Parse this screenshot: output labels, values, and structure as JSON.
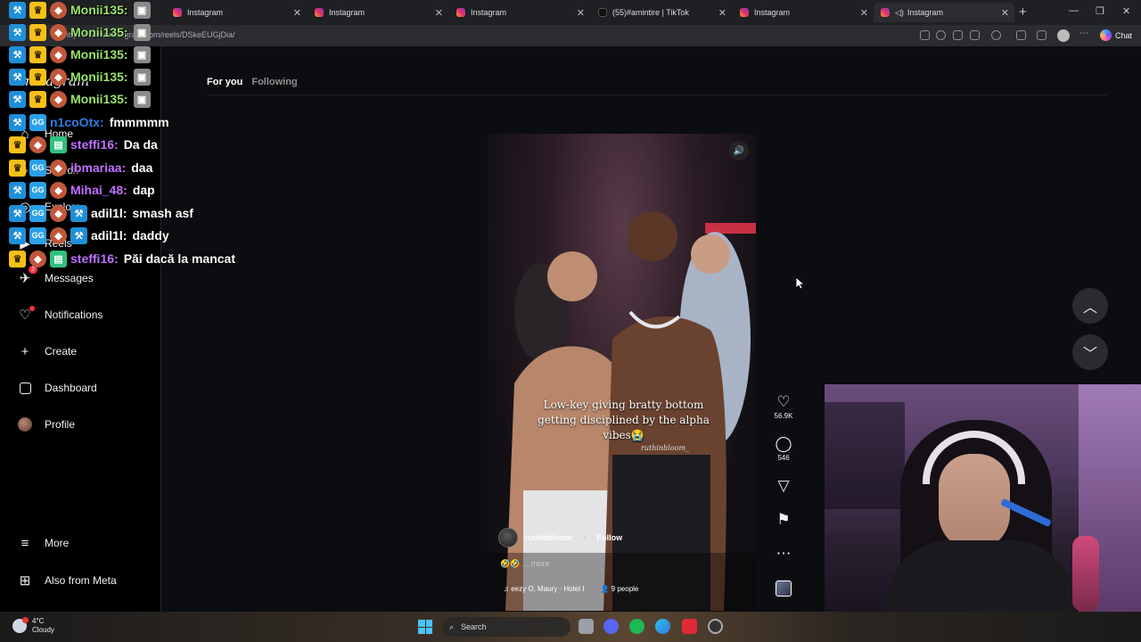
{
  "browser": {
    "tabs": [
      {
        "label": "Instagram"
      },
      {
        "label": "Instagram"
      },
      {
        "label": "Instagram"
      },
      {
        "label": "(55)#amintire | TikTok"
      },
      {
        "label": "Instagram"
      },
      {
        "label": "Instagram"
      }
    ],
    "url": "https://www.instagram.com/reels/DSkeEUGjDia/",
    "chat_label": "Chat"
  },
  "sidebar": {
    "brand": "Instagram",
    "items": [
      {
        "label": "Home",
        "icon": "home-icon"
      },
      {
        "label": "Search",
        "icon": "search-icon"
      },
      {
        "label": "Explore",
        "icon": "compass-icon"
      },
      {
        "label": "Reels",
        "icon": "reels-icon"
      },
      {
        "label": "Messages",
        "icon": "messenger-icon",
        "badge": "2"
      },
      {
        "label": "Notifications",
        "icon": "heart-icon"
      },
      {
        "label": "Create",
        "icon": "plus-icon"
      },
      {
        "label": "Dashboard",
        "icon": "dashboard-icon"
      },
      {
        "label": "Profile",
        "icon": "avatar-icon"
      },
      {
        "label": "More",
        "icon": "menu-icon"
      },
      {
        "label": "Also from Meta",
        "icon": "meta-apps-icon"
      }
    ]
  },
  "feed": {
    "tab_for_you": "For you",
    "tab_following": "Following"
  },
  "reel": {
    "caption": "Low-key giving bratty bottom getting disciplined by the alpha vibes😭",
    "watermark": "ruthinbloom_",
    "author": "ruthinbloom_",
    "follow": "Follow",
    "more": "... more",
    "music": "eezy O, Maury · Hotel I",
    "people": "9 people",
    "likes": "56.9K",
    "comments": "546"
  },
  "chat": [
    {
      "user": "Monii135:",
      "msg": "",
      "color": "#9be36b"
    },
    {
      "user": "Monii135:",
      "msg": "",
      "color": "#9be36b"
    },
    {
      "user": "Monii135:",
      "msg": "",
      "color": "#9be36b"
    },
    {
      "user": "Monii135:",
      "msg": "",
      "color": "#9be36b"
    },
    {
      "user": "Monii135:",
      "msg": "",
      "color": "#9be36b"
    },
    {
      "user": "n1coOtx:",
      "msg": "fmmmmm",
      "color": "#2e7de6"
    },
    {
      "user": "steffi16:",
      "msg": "Da da",
      "color": "#c070ff"
    },
    {
      "user": "ibmariaa:",
      "msg": "daa",
      "color": "#c070ff"
    },
    {
      "user": "Mihai_48:",
      "msg": "dap",
      "color": "#c070ff"
    },
    {
      "user": "adil1l:",
      "msg": "smash asf",
      "color": "#ffffff"
    },
    {
      "user": "adil1l:",
      "msg": "daddy",
      "color": "#ffffff"
    },
    {
      "user": "steffi16:",
      "msg": "Păi dacă la mancat",
      "color": "#c070ff"
    }
  ],
  "taskbar": {
    "temp": "4°C",
    "condition": "Cloudy",
    "search": "Search"
  }
}
